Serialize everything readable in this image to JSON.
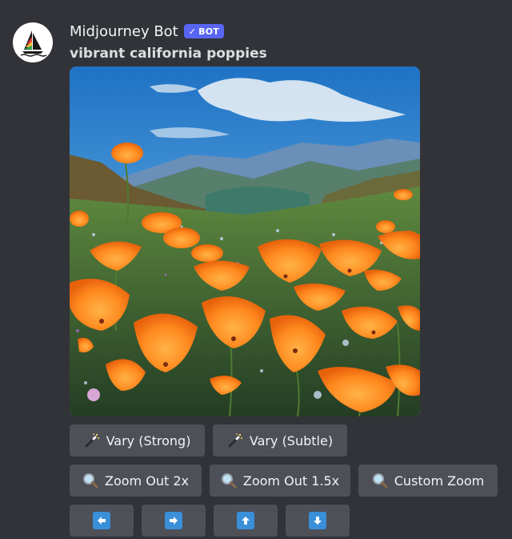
{
  "message": {
    "username": "Midjourney Bot",
    "badge": {
      "check": "✓",
      "label": "BOT"
    },
    "prompt": "vibrant california poppies",
    "image_alt": "vibrant california poppies"
  },
  "buttons": {
    "row1": [
      {
        "label": "Vary (Strong)",
        "icon": "magic-wand-icon"
      },
      {
        "label": "Vary (Subtle)",
        "icon": "magic-wand-icon"
      }
    ],
    "row2": [
      {
        "label": "Zoom Out 2x",
        "icon": "magnifier-icon"
      },
      {
        "label": "Zoom Out 1.5x",
        "icon": "magnifier-icon"
      },
      {
        "label": "Custom Zoom",
        "icon": "magnifier-icon"
      }
    ],
    "row3": [
      {
        "icon": "arrow-left-icon"
      },
      {
        "icon": "arrow-right-icon"
      },
      {
        "icon": "arrow-up-icon"
      },
      {
        "icon": "arrow-down-icon"
      }
    ]
  },
  "colors": {
    "background": "#313338",
    "button": "#4e5058",
    "bot_badge": "#5865f2",
    "arrow_emoji": "#3a8fd9"
  }
}
